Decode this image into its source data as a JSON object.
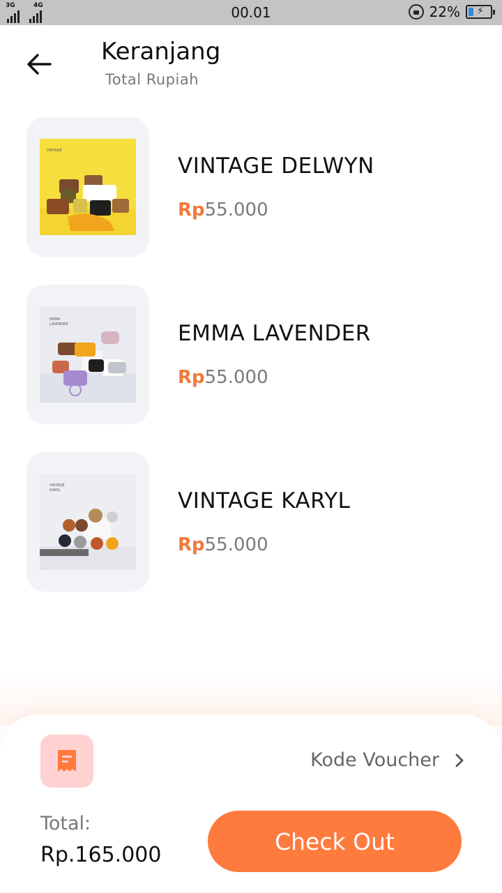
{
  "status_bar": {
    "time": "00.01",
    "network_1": "3G",
    "network_2": "4G",
    "battery_percent": "22%",
    "battery_level": 0.22
  },
  "header": {
    "back_icon": "arrow-left-icon",
    "title": "Keranjang",
    "subtitle": "Total Rupiah"
  },
  "cart": {
    "items": [
      {
        "name": "VINTAGE DELWYN",
        "currency": "Rp",
        "price": "55.000",
        "bg": "#f6df3c"
      },
      {
        "name": "EMMA LAVENDER",
        "currency": "Rp",
        "price": "55.000",
        "bg": "#e9ebf1"
      },
      {
        "name": "VINTAGE KARYL",
        "currency": "Rp",
        "price": "55.000",
        "bg": "#eceef2"
      }
    ]
  },
  "footer": {
    "voucher_icon": "receipt-icon",
    "voucher_label": "Kode Voucher",
    "voucher_chevron": "chevron-right-icon",
    "total_label": "Total:",
    "total_value": "Rp.165.000",
    "checkout_label": "Check Out"
  },
  "colors": {
    "accent": "#ff7a3d",
    "price_currency": "#f07a3c",
    "voucher_bg": "#ffd2d2",
    "card_bg": "#f2f3f7"
  }
}
